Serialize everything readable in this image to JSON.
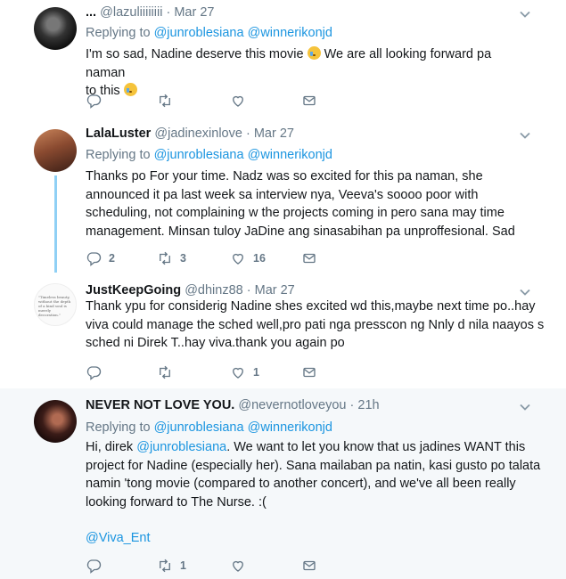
{
  "tweets": [
    {
      "name": "...",
      "handle": "@lazuliiiiiiii",
      "dot": "·",
      "time": "Mar 27",
      "replying_prefix": "Replying to",
      "replying_to": [
        "@junroblesiana",
        "@winnerikonjd"
      ],
      "text_line1": "I'm so sad, Nadine deserve this movie",
      "text_line1b": "We are all looking forward pa naman",
      "text_line2": "to this",
      "emoji": [
        "sad-tear-emoji",
        "crying-emoji"
      ],
      "counts": {
        "reply": "",
        "retweet": "",
        "like": ""
      }
    },
    {
      "name": "LalaLuster",
      "handle": "@jadinexinlove",
      "dot": "·",
      "time": "Mar 27",
      "replying_prefix": "Replying to",
      "replying_to": [
        "@junroblesiana",
        "@winnerikonjd"
      ],
      "lines": [
        "Thanks po For your time. Nadz was so excited for this pa naman, she",
        "announced it pa last week sa interview nya, Veeva's soooo poor with",
        "scheduling, not complaining w the projects coming in pero sana may time",
        "management. Minsan tuloy JaDine ang sinasabihan pa unproffesional. Sad"
      ],
      "counts": {
        "reply": "2",
        "retweet": "3",
        "like": "16"
      }
    },
    {
      "name": "JustKeepGoing",
      "handle": "@dhinz88",
      "dot": "·",
      "time": "Mar 27",
      "avatar_text": "\"Timeless beauty, without the depth of a kind soul is merely decoration.\"",
      "lines": [
        "Thank ypu for considerig Nadine shes excited wd this,maybe next time po..hay",
        "viva could manage the sched well,pro pati nga presscon ng Nnly d nila naayos s",
        "sched ni Direk T..hay viva.thank you again po"
      ],
      "counts": {
        "reply": "",
        "retweet": "",
        "like": "1"
      }
    },
    {
      "name": "NEVER NOT LOVE YOU.",
      "handle": "@nevernotloveyou",
      "dot": "·",
      "time": "21h",
      "replying_prefix": "Replying to",
      "replying_to": [
        "@junroblesiana",
        "@winnerikonjd"
      ],
      "line1_prefix": "Hi, direk",
      "line1_mention": "@junroblesiana",
      "line1_suffix": ". We want to let you know that us jadines WANT this",
      "lines": [
        "project for Nadine (especially her). Sana mailaban pa natin, kasi gusto po talata",
        "namin 'tong movie (compared to another concert), and we've all been really",
        "looking forward to The Nurse. :("
      ],
      "mention_line": "@Viva_Ent",
      "counts": {
        "reply": "",
        "retweet": "1",
        "like": ""
      }
    }
  ],
  "colors": {
    "link": "#1b95e0",
    "muted": "#657786",
    "text": "#14171a",
    "thread": "#8fd0f5"
  },
  "icons": [
    "reply-icon",
    "retweet-icon",
    "like-icon",
    "direct-message-icon",
    "chevron-down-icon"
  ]
}
